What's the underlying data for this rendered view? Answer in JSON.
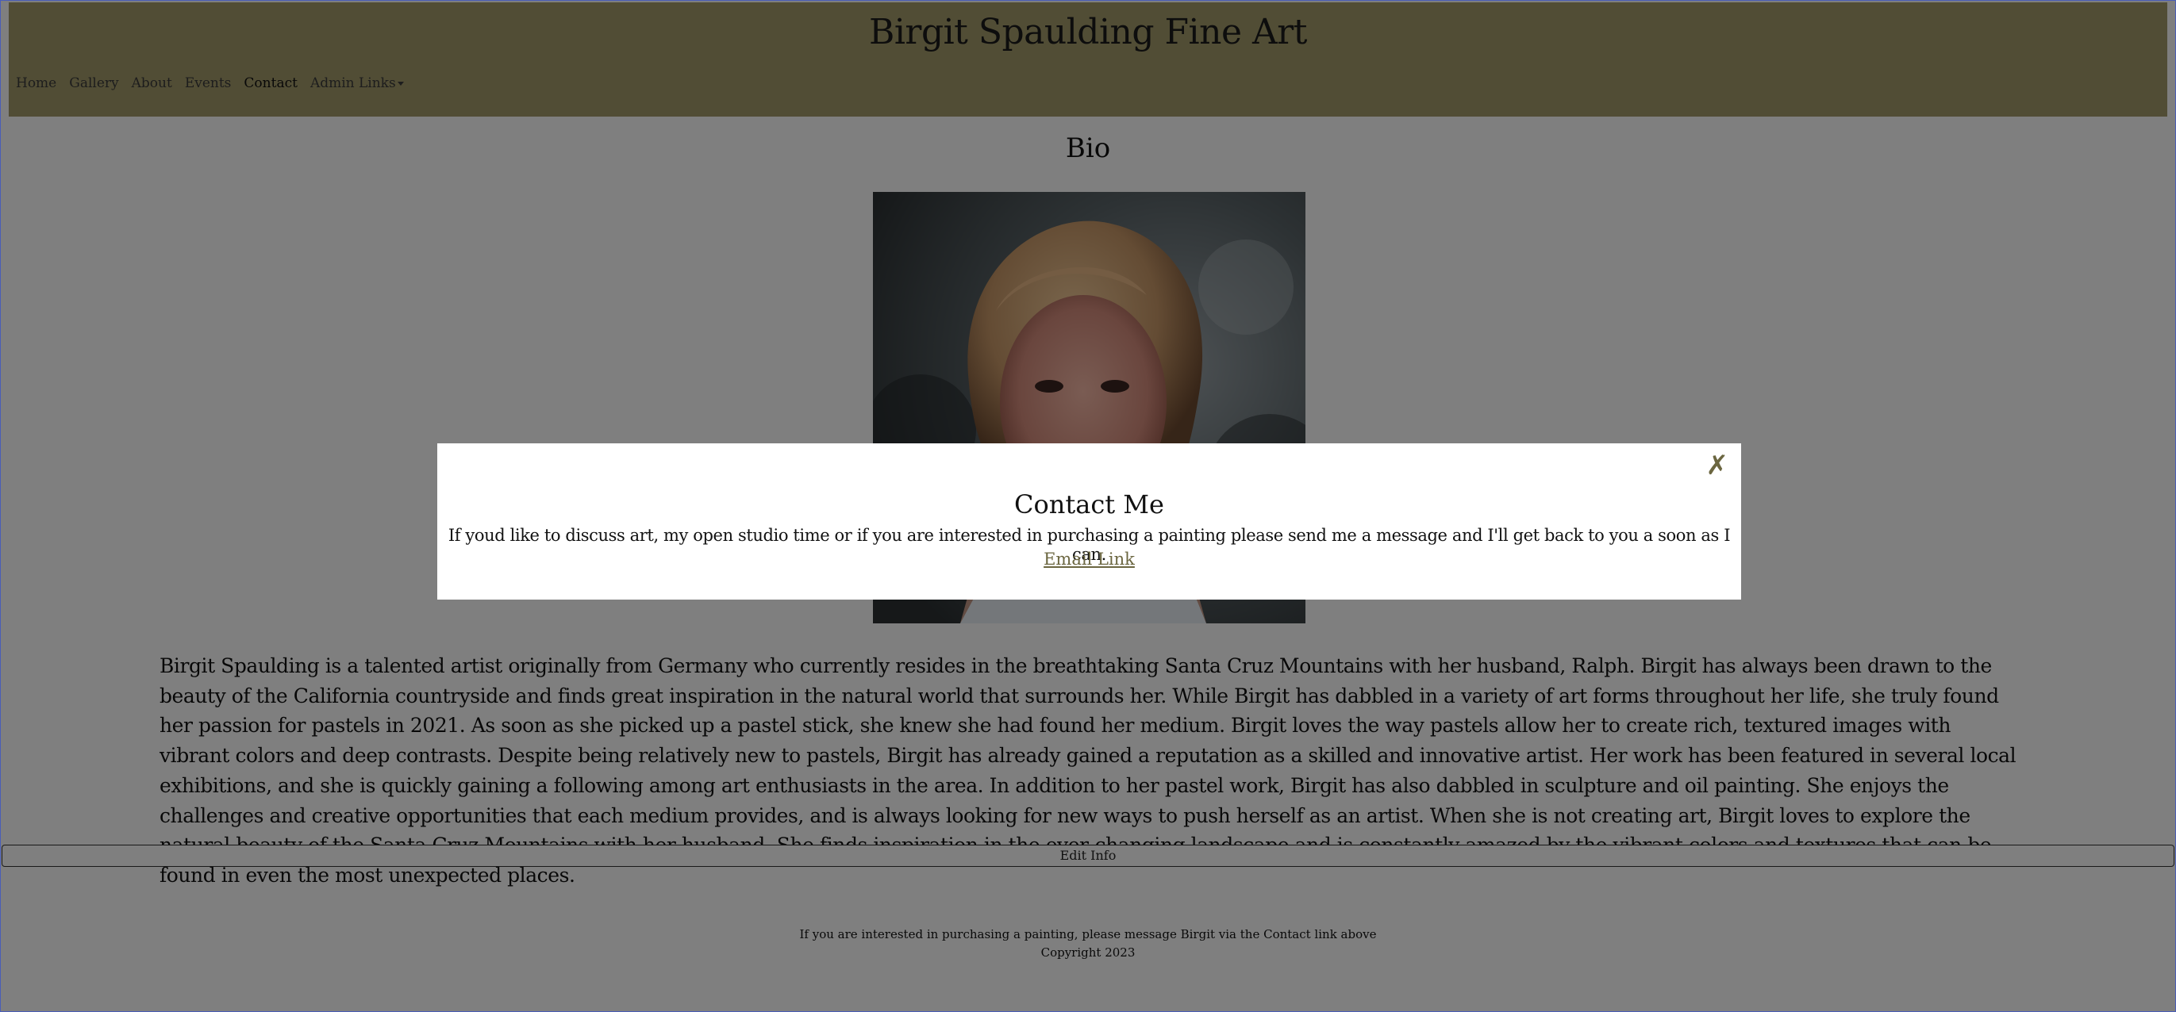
{
  "header": {
    "site_title": "Birgit Spaulding Fine Art",
    "nav": [
      {
        "label": "Home"
      },
      {
        "label": "Gallery"
      },
      {
        "label": "About"
      },
      {
        "label": "Events"
      },
      {
        "label": "Contact"
      },
      {
        "label": "Admin Links"
      }
    ]
  },
  "colors": {
    "header_bg": "#a39b6a",
    "link": "#6b6640",
    "overlay": "rgba(0,0,0,0.5)"
  },
  "bio": {
    "title": "Bio",
    "text": "Birgit Spaulding is a talented artist originally from Germany who currently resides in the breathtaking Santa Cruz Mountains with her husband, Ralph. Birgit has always been drawn to the beauty of the California countryside and finds great inspiration in the natural world that surrounds her. While Birgit has dabbled in a variety of art forms throughout her life, she truly found her passion for pastels in 2021. As soon as she picked up a pastel stick, she knew she had found her medium. Birgit loves the way pastels allow her to create rich, textured images with vibrant colors and deep contrasts. Despite being relatively new to pastels, Birgit has already gained a reputation as a skilled and innovative artist. Her work has been featured in several local exhibitions, and she is quickly gaining a following among art enthusiasts in the area. In addition to her pastel work, Birgit has also dabbled in sculpture and oil painting. She enjoys the challenges and creative opportunities that each medium provides, and is always looking for new ways to push herself as an artist. When she is not creating art, Birgit loves to explore the natural beauty of the Santa Cruz Mountains with her husband. She finds inspiration in the ever-changing landscape and is constantly amazed by the vibrant colors and textures that can be found in even the most unexpected places.",
    "edit_button": "Edit Info"
  },
  "footer": {
    "line1": "If you are interested in purchasing a painting, please message Birgit via the Contact link above",
    "line2": "Copyright 2023"
  },
  "modal": {
    "close_glyph": "✗",
    "title": "Contact Me",
    "message": "If youd like to discuss art, my open studio time or if you are interested in purchasing a painting please send me a message and I'll get back to you a soon as I can.",
    "link_label": "Email Link"
  }
}
